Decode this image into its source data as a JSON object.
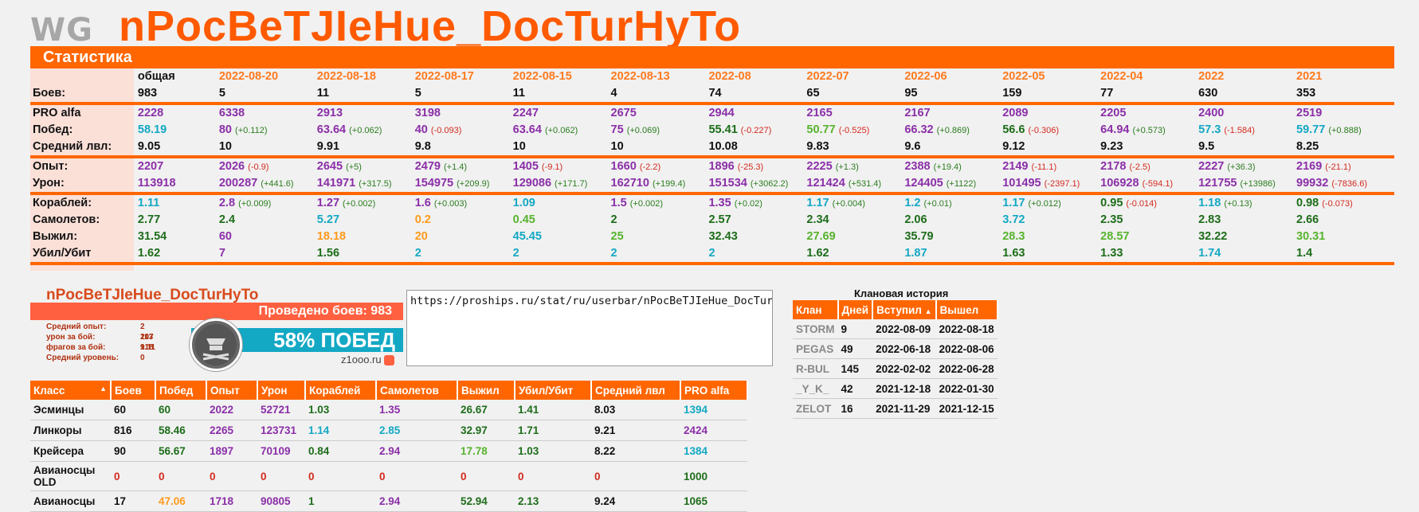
{
  "brand": {
    "logo_text": "WG"
  },
  "player_name": "nPocBeTJIeHue_DocTurHyTo",
  "section_title": "Статистика",
  "stats": {
    "periods": [
      "общая",
      "2022-08-20",
      "2022-08-18",
      "2022-08-17",
      "2022-08-15",
      "2022-08-13",
      "2022-08",
      "2022-07",
      "2022-06",
      "2022-05",
      "2022-04",
      "2022",
      "2021"
    ],
    "battles_label": "Боев:",
    "battles": [
      "983",
      "5",
      "11",
      "5",
      "11",
      "4",
      "74",
      "65",
      "95",
      "159",
      "77",
      "630",
      "353"
    ],
    "pro_label": "PRO alfa",
    "pro": [
      "2228",
      "6338",
      "2913",
      "3198",
      "2247",
      "2675",
      "2944",
      "2165",
      "2167",
      "2089",
      "2205",
      "2400",
      "2519"
    ],
    "wins_label": "Побед:",
    "wins": [
      "58.19",
      "80",
      "63.64",
      "40",
      "63.64",
      "75",
      "55.41",
      "50.77",
      "66.32",
      "56.6",
      "64.94",
      "57.3",
      "59.77"
    ],
    "wins_d": [
      "",
      "(+0.112)",
      "(+0.062)",
      "(-0.093)",
      "(+0.062)",
      "(+0.069)",
      "(-0.227)",
      "(-0.525)",
      "(+0.869)",
      "(-0.306)",
      "(+0.573)",
      "(-1.584)",
      "(+0.888)"
    ],
    "lvl_label": "Средний лвл:",
    "lvl": [
      "9.05",
      "10",
      "9.91",
      "9.8",
      "10",
      "10",
      "10.08",
      "9.83",
      "9.6",
      "9.12",
      "9.23",
      "9.5",
      "8.25"
    ],
    "exp_label": "Опыт:",
    "exp": [
      "2207",
      "2026",
      "2645",
      "2479",
      "1405",
      "1660",
      "1896",
      "2225",
      "2388",
      "2149",
      "2178",
      "2227",
      "2169"
    ],
    "exp_d": [
      "",
      "(-0.9)",
      "(+5)",
      "(+1.4)",
      "(-9.1)",
      "(-2.2)",
      "(-25.3)",
      "(+1.3)",
      "(+19.4)",
      "(-11.1)",
      "(-2.5)",
      "(+36.3)",
      "(-21.1)"
    ],
    "dmg_label": "Урон:",
    "dmg": [
      "113918",
      "200287",
      "141971",
      "154975",
      "129086",
      "162710",
      "151534",
      "121424",
      "124405",
      "101495",
      "106928",
      "121755",
      "99932"
    ],
    "dmg_d": [
      "",
      "(+441.6)",
      "(+317.5)",
      "(+209.9)",
      "(+171.7)",
      "(+199.4)",
      "(+3062.2)",
      "(+531.4)",
      "(+1122)",
      "(-2397.1)",
      "(-594.1)",
      "(+13986)",
      "(-7836.6)"
    ],
    "ships_label": "Кораблей:",
    "ships": [
      "1.11",
      "2.8",
      "1.27",
      "1.6",
      "1.09",
      "1.5",
      "1.35",
      "1.17",
      "1.2",
      "1.17",
      "0.95",
      "1.18",
      "0.98"
    ],
    "ships_d": [
      "",
      "(+0.009)",
      "(+0.002)",
      "(+0.003)",
      "",
      "(+0.002)",
      "(+0.02)",
      "(+0.004)",
      "(+0.01)",
      "(+0.012)",
      "(-0.014)",
      "(+0.13)",
      "(-0.073)"
    ],
    "planes_label": "Самолетов:",
    "planes": [
      "2.77",
      "2.4",
      "5.27",
      "0.2",
      "0.45",
      "2",
      "2.57",
      "2.34",
      "2.06",
      "3.72",
      "2.35",
      "2.83",
      "2.66"
    ],
    "surv_label": "Выжил:",
    "surv": [
      "31.54",
      "60",
      "18.18",
      "20",
      "45.45",
      "25",
      "32.43",
      "27.69",
      "35.79",
      "28.3",
      "28.57",
      "32.22",
      "30.31"
    ],
    "kd_label": "Убил/Убит",
    "kd": [
      "1.62",
      "7",
      "1.56",
      "2",
      "2",
      "2",
      "2",
      "1.62",
      "1.87",
      "1.63",
      "1.33",
      "1.74",
      "1.4"
    ]
  },
  "banner": {
    "name": "nPocBeTJIeHue_DocTurHyTo",
    "battles_text": "Проведено боев: 983",
    "winrate_text": "58% ПОБЕД",
    "site": "z1ooo.ru",
    "lines": [
      {
        "k": "Средний опыт:",
        "v": "2 207"
      },
      {
        "k": "урон за бой:",
        "v": "113 918"
      },
      {
        "k": "фрагов за бой:",
        "v": "1.11"
      },
      {
        "k": "Средний уровень:",
        "v": "0"
      }
    ]
  },
  "userbar_url": "https://proships.ru/stat/ru/userbar/nPocBeTJIeHue_DocTurHyTo.png",
  "clan_history": {
    "title": "Клановая история",
    "headers": [
      "Клан",
      "Дней",
      "Вступил",
      "Вышел"
    ],
    "rows": [
      [
        "STORM",
        "9",
        "2022-08-09",
        "2022-08-18"
      ],
      [
        "PEGAS",
        "49",
        "2022-06-18",
        "2022-08-06"
      ],
      [
        "R-BUL",
        "145",
        "2022-02-02",
        "2022-06-28"
      ],
      [
        "_Y_K_",
        "42",
        "2021-12-18",
        "2022-01-30"
      ],
      [
        "ZELOT",
        "16",
        "2021-11-29",
        "2021-12-15"
      ]
    ]
  },
  "class_table": {
    "headers": [
      "Класс",
      "Боев",
      "Побед",
      "Опыт",
      "Урон",
      "Кораблей",
      "Самолетов",
      "Выжил",
      "Убил/Убит",
      "Средний лвл",
      "PRO alfa"
    ],
    "rows": [
      [
        "Эсминцы",
        "60",
        "60",
        "2022",
        "52721",
        "1.03",
        "1.35",
        "26.67",
        "1.41",
        "8.03",
        "1394"
      ],
      [
        "Линкоры",
        "816",
        "58.46",
        "2265",
        "123731",
        "1.14",
        "2.85",
        "32.97",
        "1.71",
        "9.21",
        "2424"
      ],
      [
        "Крейсера",
        "90",
        "56.67",
        "1897",
        "70109",
        "0.84",
        "2.94",
        "17.78",
        "1.03",
        "8.22",
        "1384"
      ],
      [
        "Авианосцы OLD",
        "0",
        "0",
        "0",
        "0",
        "0",
        "0",
        "0",
        "0",
        "0",
        "1000"
      ],
      [
        "Авианосцы",
        "17",
        "47.06",
        "1718",
        "90805",
        "1",
        "2.94",
        "52.94",
        "2.13",
        "9.24",
        "1065"
      ]
    ]
  }
}
